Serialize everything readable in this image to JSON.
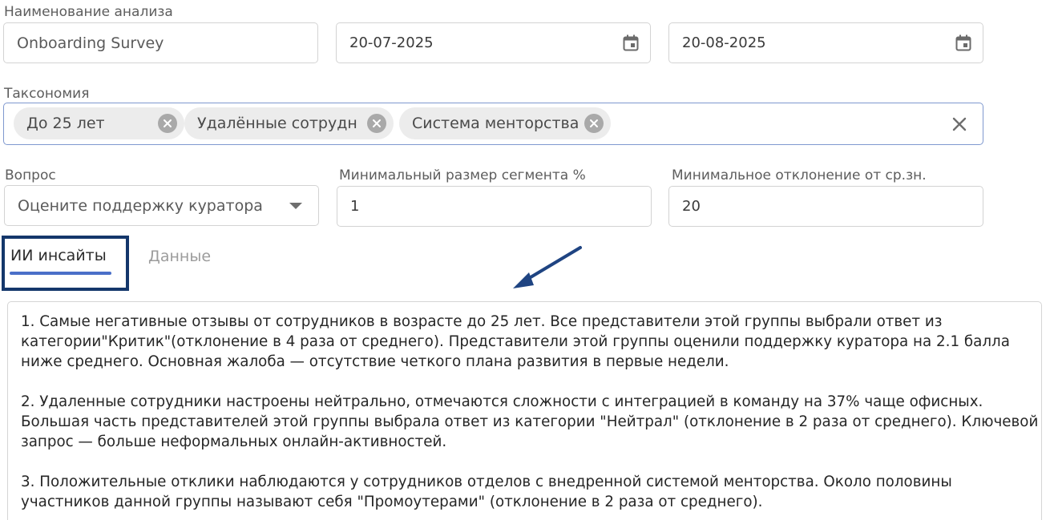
{
  "form": {
    "analysis_name_label": "Наименование анализа",
    "analysis_name_value": "Onboarding Survey",
    "date_from": "20-07-2025",
    "date_to": "20-08-2025",
    "taxonomy_label": "Таксономия",
    "taxonomy_chips": [
      "До 25 лет",
      "Удалённые сотрудн",
      "Система менторства"
    ],
    "question_label": "Вопрос",
    "question_value": "Оцените поддержку куратора",
    "min_segment_label": "Минимальный размер сегмента %",
    "min_segment_value": "1",
    "min_deviation_label": "Минимальное отклонение от ср.зн.",
    "min_deviation_value": "20"
  },
  "tabs": {
    "active": "ИИ инсайты",
    "inactive": "Данные"
  },
  "insights": [
    "1. Самые негативные отзывы от сотрудников в возрасте до 25 лет. Все представители этой группы выбрали ответ из категории\"Критик\"(отклонение в 4 раза от среднего). Представители этой группы оценили поддержку куратора на 2.1 балла ниже среднего. Основная жалоба — отсутствие четкого плана развития в первые недели.",
    "2. Удаленные сотрудники настроены нейтрально, отмечаются сложности с интеграцией в команду на 37% чаще офисных. Большая часть представителей этой группы выбрала ответ из категории \"Нейтрал\" (отклонение в 2 раза от среднего). Ключевой запрос — больше неформальных онлайн-активностей.",
    "3. Положительные отклики наблюдаются у сотрудников отделов с внедренной системой менторства. Около половины участников данной группы называют себя \"Промоутерами\" (отклонение в 2 раза от среднего)."
  ],
  "icons": {
    "date_icon": "calendar-icon",
    "chip_remove_icon": "close-circle-icon",
    "clear_icon": "close-icon",
    "select_icon": "caret-down-icon",
    "annotation_icon": "arrow-icon"
  },
  "colors": {
    "accent": "#4a6fc8",
    "highlight_box": "#14376b",
    "annotation_arrow": "#1f4482"
  }
}
